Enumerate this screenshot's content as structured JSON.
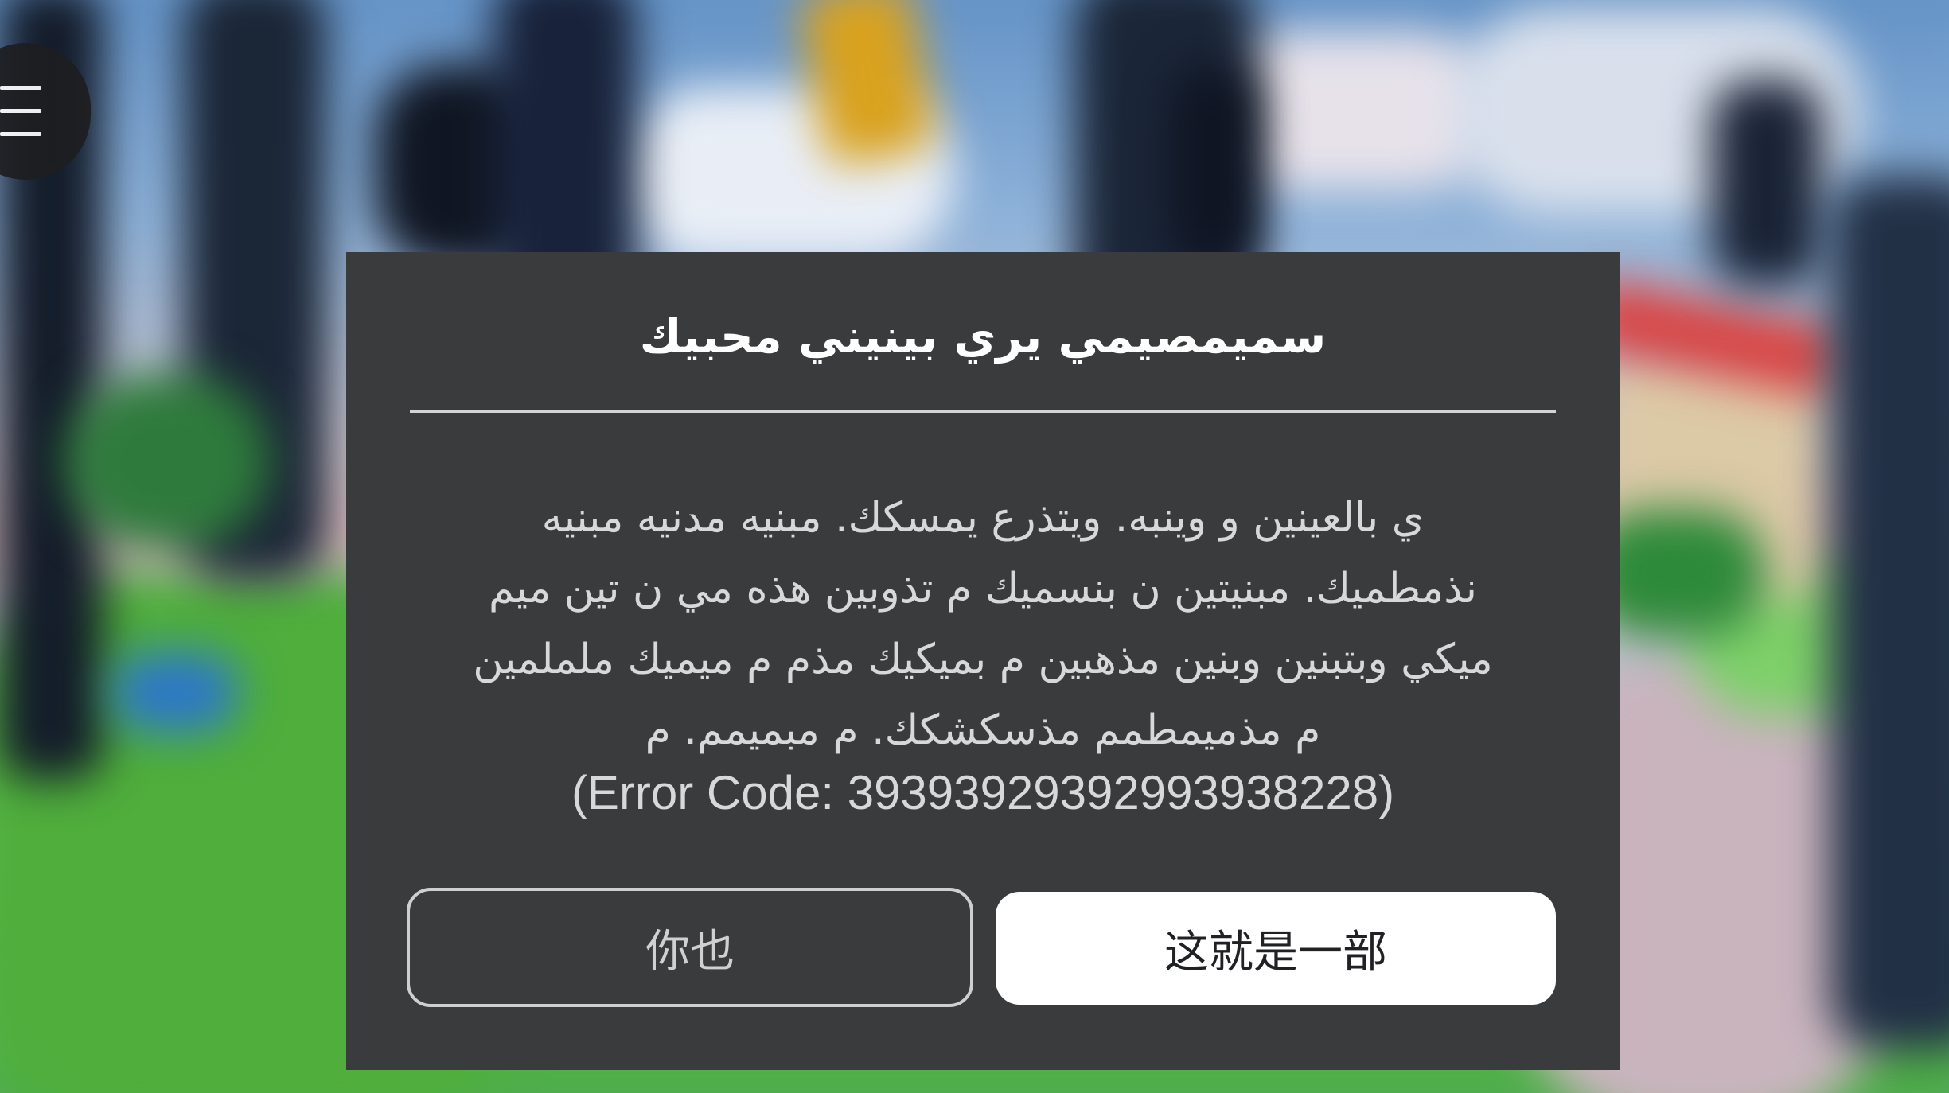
{
  "menu": {
    "icon": "hamburger-menu-icon"
  },
  "dialog": {
    "title": "سميمصيمي يري بينيني محبيك",
    "message_lines": [
      "ي بالعينين و وينبه. ويتذرع يمسكك. مبنيه مدنيه مبنيه",
      "نذمطميك. مبنيتين ن بنسميك م تذوبين هذه مي ن تين ميم",
      "ميكي وبتبنين  وبنين مذهبين م بميكيك مذم م ميميك ململمين",
      "م مذميمطمم مذسكشكك. م مبميمم. م"
    ],
    "error_code": "(Error Code: 3939392939299393822​8)",
    "buttons": {
      "secondary_label": "你也",
      "primary_label": "这就是一部"
    }
  },
  "colors": {
    "dialog_background": "#393b3d",
    "primary_button": "#ffffff",
    "text": "#d8d8d8"
  }
}
